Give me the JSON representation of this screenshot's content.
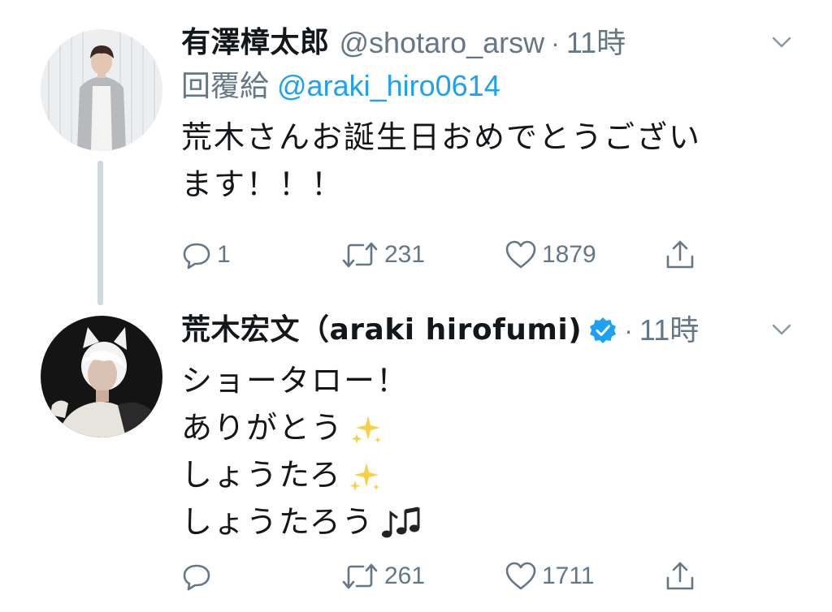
{
  "tweets": [
    {
      "display_name": "有澤樟太郎",
      "handle": "@shotaro_arsw",
      "separator": "·",
      "time": "11時",
      "reply_prefix": "回覆給",
      "reply_to": "@araki_hiro0614",
      "text_lines": [
        "荒木さんお誕生日おめでとうござい",
        "ます！！！"
      ],
      "counts": {
        "replies": "1",
        "retweets": "231",
        "likes": "1879"
      }
    },
    {
      "display_name": "荒木宏文（araki hirofumi)",
      "handle": "",
      "separator": "·",
      "time": "11時",
      "verified": true,
      "text_lines": [
        "ショータロー！",
        "ありがとう",
        "しょうたろ",
        "しょうたろう"
      ],
      "counts": {
        "replies": "",
        "retweets": "261",
        "likes": "1711"
      }
    }
  ],
  "colors": {
    "secondary_text": "#657786",
    "link": "#1da1f2",
    "thread_line": "#cfd9de",
    "verified_badge": "#1da1f2"
  },
  "icons": [
    "chevron-down-icon",
    "reply-icon",
    "retweet-icon",
    "like-icon",
    "share-icon",
    "verified-icon",
    "sparkles-emoji",
    "music-notes-emoji"
  ]
}
